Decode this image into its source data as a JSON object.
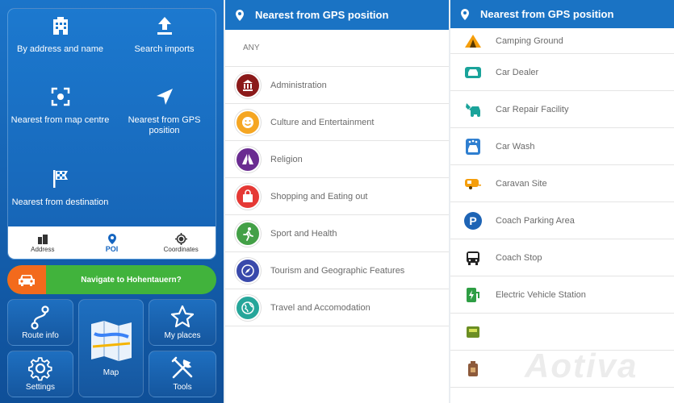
{
  "search": {
    "options": [
      {
        "label": "By address and name",
        "icon": "building-icon"
      },
      {
        "label": "Search imports",
        "icon": "upload-icon"
      },
      {
        "label": "Nearest from map centre",
        "icon": "map-centre-icon"
      },
      {
        "label": "Nearest from GPS position",
        "icon": "gps-arrow-icon"
      },
      {
        "label": "Nearest from destination",
        "icon": "checkered-flag-icon"
      }
    ],
    "tabs": [
      {
        "label": "Address",
        "icon": "address-icon"
      },
      {
        "label": "POI",
        "icon": "poi-pin-icon",
        "active": true
      },
      {
        "label": "Coordinates",
        "icon": "crosshair-icon"
      }
    ]
  },
  "navigate": {
    "label": "Navigate to Hohentauern?"
  },
  "tiles": {
    "route_info": "Route info",
    "map": "Map",
    "my_places": "My places",
    "settings": "Settings",
    "tools": "Tools"
  },
  "list_panel": {
    "title": "Nearest from GPS position",
    "any_label": "ANY",
    "categories": [
      {
        "label": "Administration",
        "color": "#8b1a1a"
      },
      {
        "label": "Culture and Entertainment",
        "color": "#f5a623"
      },
      {
        "label": "Religion",
        "color": "#6a2c91"
      },
      {
        "label": "Shopping and Eating out",
        "color": "#e53935"
      },
      {
        "label": "Sport and Health",
        "color": "#43a047"
      },
      {
        "label": "Tourism and Geographic Features",
        "color": "#3949ab"
      },
      {
        "label": "Travel and Accomodation",
        "color": "#26a69a"
      }
    ]
  },
  "sub_panel": {
    "title": "Nearest from GPS position",
    "items": [
      {
        "label": "Camping Ground",
        "icon": "tent-icon",
        "color": "#f59e0b"
      },
      {
        "label": "Car Dealer",
        "icon": "car-dealer-icon",
        "color": "#1aa39a"
      },
      {
        "label": "Car Repair Facility",
        "icon": "car-repair-icon",
        "color": "#1aa39a"
      },
      {
        "label": "Car Wash",
        "icon": "car-wash-icon",
        "color": "#2f7fd0"
      },
      {
        "label": "Caravan Site",
        "icon": "caravan-icon",
        "color": "#f59e0b"
      },
      {
        "label": "Coach Parking Area",
        "icon": "parking-icon",
        "color": "#1e64b5"
      },
      {
        "label": "Coach Stop",
        "icon": "bus-icon",
        "color": "#222222"
      },
      {
        "label": "Electric Vehicle Station",
        "icon": "ev-station-icon",
        "color": "#2e9e44"
      },
      {
        "label": "",
        "icon": "fuel-icon",
        "color": "#6b8e23"
      },
      {
        "label": "",
        "icon": "gas-can-icon",
        "color": "#8d5a3b"
      }
    ]
  },
  "watermark": "Aotiva"
}
